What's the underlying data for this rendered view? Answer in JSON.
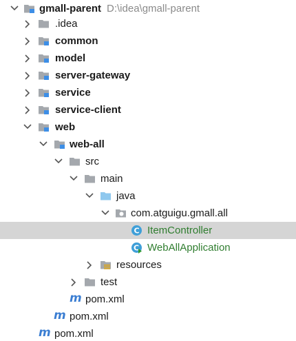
{
  "tree": {
    "root": {
      "label": "gmall-parent",
      "path": "D:\\idea\\gmall-parent"
    },
    "idea": {
      "label": ".idea"
    },
    "common": {
      "label": "common"
    },
    "model": {
      "label": "model"
    },
    "server_gateway": {
      "label": "server-gateway"
    },
    "service": {
      "label": "service"
    },
    "service_client": {
      "label": "service-client"
    },
    "web": {
      "label": "web"
    },
    "web_all": {
      "label": "web-all"
    },
    "src": {
      "label": "src"
    },
    "main": {
      "label": "main"
    },
    "java": {
      "label": "java"
    },
    "package": {
      "label": "com.atguigu.gmall.all"
    },
    "item_controller": {
      "label": "ItemController"
    },
    "web_all_application": {
      "label": "WebAllApplication"
    },
    "resources": {
      "label": "resources"
    },
    "test": {
      "label": "test"
    },
    "pom_web_all": {
      "label": "pom.xml"
    },
    "pom_web": {
      "label": "pom.xml"
    },
    "pom_root": {
      "label": "pom.xml"
    }
  },
  "colors": {
    "selection": "#d5d5d5",
    "folder": "#a4a8ad",
    "module_marker": "#3d8ee6",
    "source_folder": "#8fc8ee",
    "class_icon": "#3f9fd8",
    "green_text": "#2f7d2f",
    "maven_icon": "#3b7ed2"
  },
  "icons": {
    "expanded": "chevron-down-icon",
    "collapsed": "chevron-right-icon",
    "module": "module-folder-icon",
    "folder": "folder-icon",
    "source_root": "source-root-folder-icon",
    "package": "package-icon",
    "class": "class-icon",
    "spring_app": "spring-boot-class-icon",
    "resources": "resources-folder-icon",
    "maven": "maven-pom-icon"
  }
}
